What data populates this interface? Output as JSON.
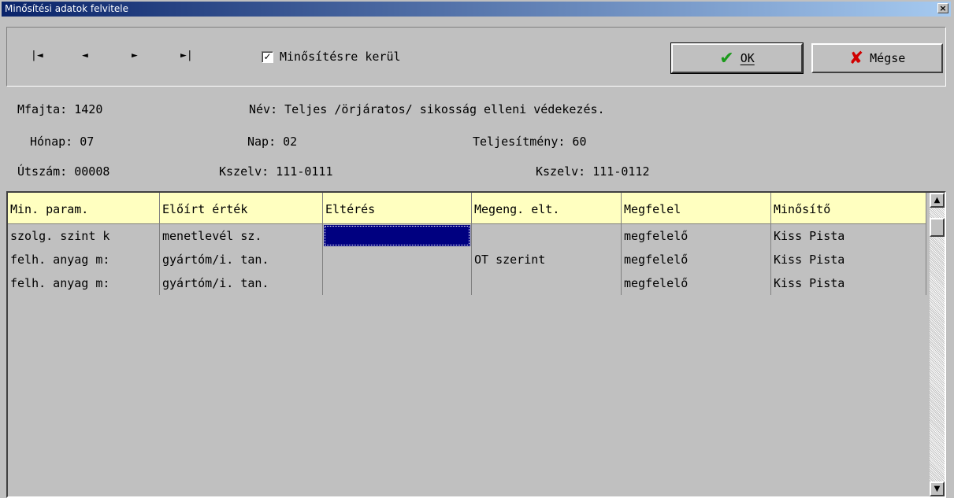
{
  "window": {
    "title": "Minősítési adatok felvitele",
    "close_glyph": "×"
  },
  "toolbar": {
    "nav_first": "|◄",
    "nav_prev": "◄",
    "nav_next": "►",
    "nav_last": "►|",
    "checkbox_checked": true,
    "checkbox_mark": "✓",
    "checkbox_label": "Minősítésre kerül",
    "ok_label": "OK",
    "ok_icon": "✔",
    "cancel_label": "Mégse",
    "cancel_icon": "✘"
  },
  "fields": {
    "mfajta": "Mfajta: 1420",
    "nev": "Név: Teljes /örjáratos/ sikosság elleni védekezés.",
    "honap": "Hónap: 07",
    "nap": "Nap: 02",
    "teljesitmeny": "Teljesítmény: 60",
    "utszam": "Útszám: 00008",
    "kszelv1": "Kszelv: 111-0111",
    "kszelv2": "Kszelv: 111-0112"
  },
  "grid": {
    "columns": [
      "Min. param.",
      "Előírt érték",
      "Eltérés",
      "Megeng. elt.",
      "Megfelel",
      "Minősítő"
    ],
    "rows": [
      [
        "szolg. szint k",
        "menetlevél sz.",
        "",
        "",
        "megfelelő",
        "Kiss Pista"
      ],
      [
        "felh. anyag m:",
        "gyártóm/i. tan.",
        "",
        "OT szerint",
        "megfelelő",
        "Kiss Pista"
      ],
      [
        "felh. anyag m:",
        "gyártóm/i. tan.",
        "",
        "",
        "megfelelő",
        "Kiss Pista"
      ]
    ],
    "selected_cell": {
      "row": 0,
      "col": 2
    }
  },
  "scrollbar": {
    "up": "▲",
    "down": "▼"
  }
}
